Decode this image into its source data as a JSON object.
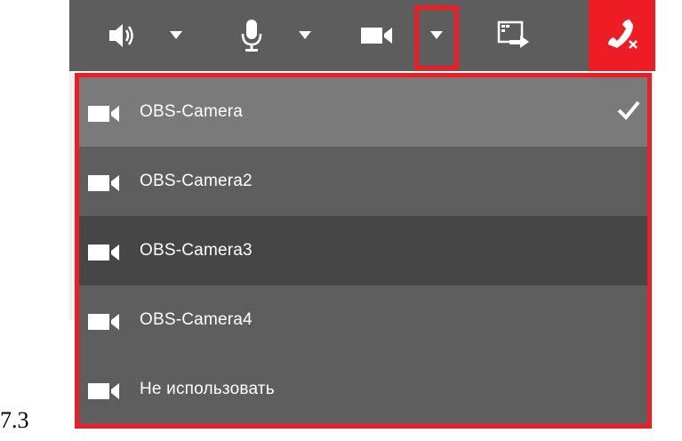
{
  "menu": {
    "items": [
      {
        "label": "OBS-Camera",
        "selected": true,
        "bg": "#7a7a7a"
      },
      {
        "label": "OBS-Camera2",
        "selected": false,
        "bg": "#5e5e5e"
      },
      {
        "label": "OBS-Camera3",
        "selected": false,
        "bg": "#464646"
      },
      {
        "label": "OBS-Camera4",
        "selected": false,
        "bg": "#5e5e5e"
      },
      {
        "label": "Не использовать",
        "selected": false,
        "bg": "#5e5e5e"
      }
    ]
  },
  "caption": "7.3",
  "colors": {
    "toolbar": "#5d5d5d",
    "highlight": "#ee1c24",
    "hangup": "#ee1c24"
  },
  "icons": {
    "speaker": "speaker-icon",
    "mic": "microphone-icon",
    "camera": "camera-icon",
    "share": "screen-share-icon",
    "hangup": "hangup-icon",
    "check": "checkmark-icon"
  }
}
